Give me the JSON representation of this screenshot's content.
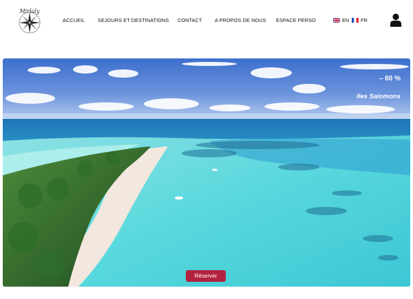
{
  "logo": {
    "text": "Mirlaly"
  },
  "nav": {
    "items": [
      {
        "label": "ACCUEIL"
      },
      {
        "label": "SEJOURS ET DESTINATIONS"
      },
      {
        "label": "CONTACT"
      },
      {
        "label": "A PROPOS DE NOUS"
      },
      {
        "label": "ESPACE PERSO"
      }
    ]
  },
  "languages": [
    {
      "code": "EN",
      "icon": "uk-flag-icon"
    },
    {
      "code": "FR",
      "icon": "france-flag-icon"
    }
  ],
  "account": {
    "icon": "user-icon"
  },
  "hero": {
    "discount": "– 60 %",
    "destination": "Iles Salomons",
    "cta_label": "Réserver"
  },
  "colors": {
    "cta": "#b3233f",
    "sky": "#4a7fd6",
    "lagoon": "#3fd0d4"
  }
}
